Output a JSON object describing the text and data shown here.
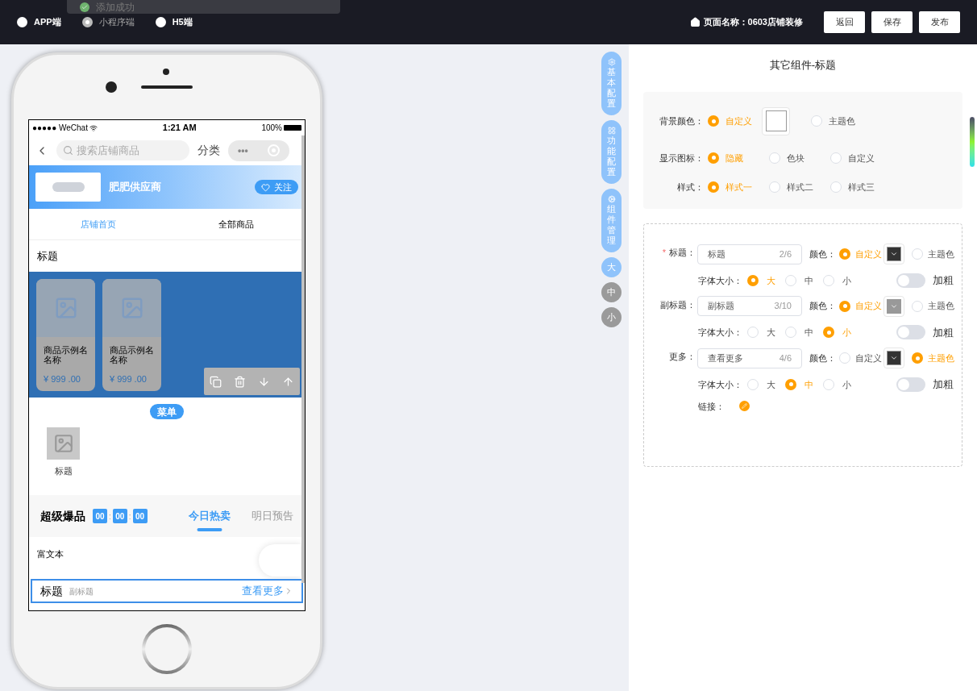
{
  "toast": {
    "text": "添加成功"
  },
  "platforms": [
    {
      "label": "APP端",
      "selected": false
    },
    {
      "label": "小程序端",
      "selected": true
    },
    {
      "label": "H5端",
      "selected": false
    }
  ],
  "page_name": "页面名称：0603店铺装修",
  "actions": [
    "返回",
    "保存",
    "发布"
  ],
  "phone": {
    "status": {
      "carrier": "●●●●● WeChat",
      "time": "1:21 AM",
      "battery": "100%"
    },
    "search": {
      "placeholder": "搜索店铺商品"
    },
    "category": "分类",
    "capsule_dots": "•••",
    "store": {
      "name": "肥肥供应商",
      "follow": "关注"
    },
    "tabs": [
      {
        "label": "店铺首页",
        "selected": true
      },
      {
        "label": "全部商品",
        "selected": false
      }
    ],
    "title": "标题",
    "products": [
      {
        "name": "商品示例名名称",
        "price": "¥ 999 .00"
      },
      {
        "name": "商品示例名名称",
        "price": "¥ 999 .00"
      }
    ],
    "menu": {
      "badge": "菜单",
      "items": [
        {
          "label": "标题"
        }
      ]
    },
    "flash": {
      "title": "超级爆品",
      "timer": [
        "00",
        "00",
        "00"
      ],
      "separator": ":",
      "tabs": [
        {
          "label": "今日热卖",
          "selected": true
        },
        {
          "label": "明日预告",
          "selected": false
        }
      ]
    },
    "rich_text": "富文本",
    "title_bar": {
      "title": "标题",
      "subtitle": "副标题",
      "more": "查看更多"
    }
  },
  "side_tabs": [
    {
      "label": "基本配置",
      "kind": "gear"
    },
    {
      "label": "功能配置",
      "kind": "grid"
    },
    {
      "label": "组件管理",
      "kind": "cog"
    }
  ],
  "sizes": [
    {
      "label": "大",
      "selected": true
    },
    {
      "label": "中",
      "selected": false
    },
    {
      "label": "小",
      "selected": false
    }
  ],
  "panel": {
    "title": "其它组件-标题",
    "basic": [
      {
        "label": "背景颜色：",
        "options": [
          {
            "label": "自定义",
            "selected": true,
            "color": "#ffffff"
          },
          {
            "label": "主题色",
            "selected": false
          }
        ]
      },
      {
        "label": "显示图标：",
        "options": [
          {
            "label": "隐藏",
            "selected": true
          },
          {
            "label": "色块",
            "selected": false
          },
          {
            "label": "自定义",
            "selected": false
          }
        ]
      },
      {
        "label": "样式：",
        "options": [
          {
            "label": "样式一",
            "selected": true
          },
          {
            "label": "样式二",
            "selected": false
          },
          {
            "label": "样式三",
            "selected": false
          }
        ]
      }
    ],
    "texts": [
      {
        "required_mark": "*",
        "label": "标题：",
        "value": "标题",
        "count": "2/6",
        "color_label": "颜色：",
        "color_options": [
          {
            "label": "自定义",
            "selected": true,
            "color": "#333333"
          },
          {
            "label": "主题色",
            "selected": false
          }
        ],
        "size_label": "字体大小：",
        "sizes": [
          {
            "label": "大",
            "selected": true
          },
          {
            "label": "中",
            "selected": false
          },
          {
            "label": "小",
            "selected": false
          }
        ],
        "bold_label": "加粗",
        "bold": false
      },
      {
        "label": "副标题：",
        "value": "副标题",
        "count": "3/10",
        "color_label": "颜色：",
        "color_options": [
          {
            "label": "自定义",
            "selected": true,
            "color": "#999999"
          },
          {
            "label": "主题色",
            "selected": false
          }
        ],
        "size_label": "字体大小：",
        "sizes": [
          {
            "label": "大",
            "selected": false
          },
          {
            "label": "中",
            "selected": false
          },
          {
            "label": "小",
            "selected": true
          }
        ],
        "bold_label": "加粗",
        "bold": false
      },
      {
        "label": "更多：",
        "value": "查看更多",
        "count": "4/6",
        "color_label": "颜色：",
        "color_options": [
          {
            "label": "自定义",
            "selected": false,
            "color": "#333333"
          },
          {
            "label": "主题色",
            "selected": true
          }
        ],
        "size_label": "字体大小：",
        "sizes": [
          {
            "label": "大",
            "selected": false
          },
          {
            "label": "中",
            "selected": true
          },
          {
            "label": "小",
            "selected": false
          }
        ],
        "bold_label": "加粗",
        "bold": false
      }
    ],
    "link_label": "链接："
  }
}
